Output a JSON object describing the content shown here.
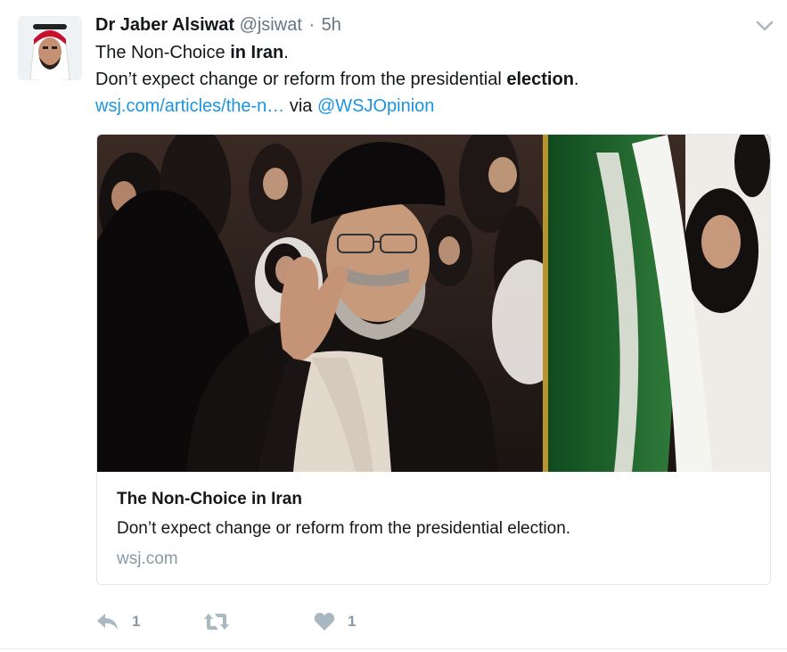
{
  "tweet": {
    "author_name": "Dr Jaber Alsiwat",
    "handle": "@jsiwat",
    "separator": "·",
    "time": "5h",
    "line1": {
      "prefix": "The Non-Choice ",
      "bold": "in Iran",
      "suffix": "."
    },
    "line2": {
      "prefix": "Don’t expect change or reform from the presidential ",
      "bold": "election",
      "suffix": "."
    },
    "link_text": "wsj.com/articles/the-n…",
    "via_text": " via ",
    "mention": "@WSJOpinion"
  },
  "card": {
    "title": "The Non-Choice in Iran",
    "description": "Don’t expect change or reform from the presidential election.",
    "domain": "wsj.com"
  },
  "actions": {
    "reply_count": "1",
    "retweet_count": "",
    "like_count": "1"
  },
  "icons": {
    "reply": "reply-icon",
    "retweet": "retweet-icon",
    "like": "heart-icon",
    "caret": "chevron-down-icon"
  },
  "colors": {
    "link": "#1b95e0",
    "muted": "#657786",
    "action_gray": "#aab8c2"
  }
}
